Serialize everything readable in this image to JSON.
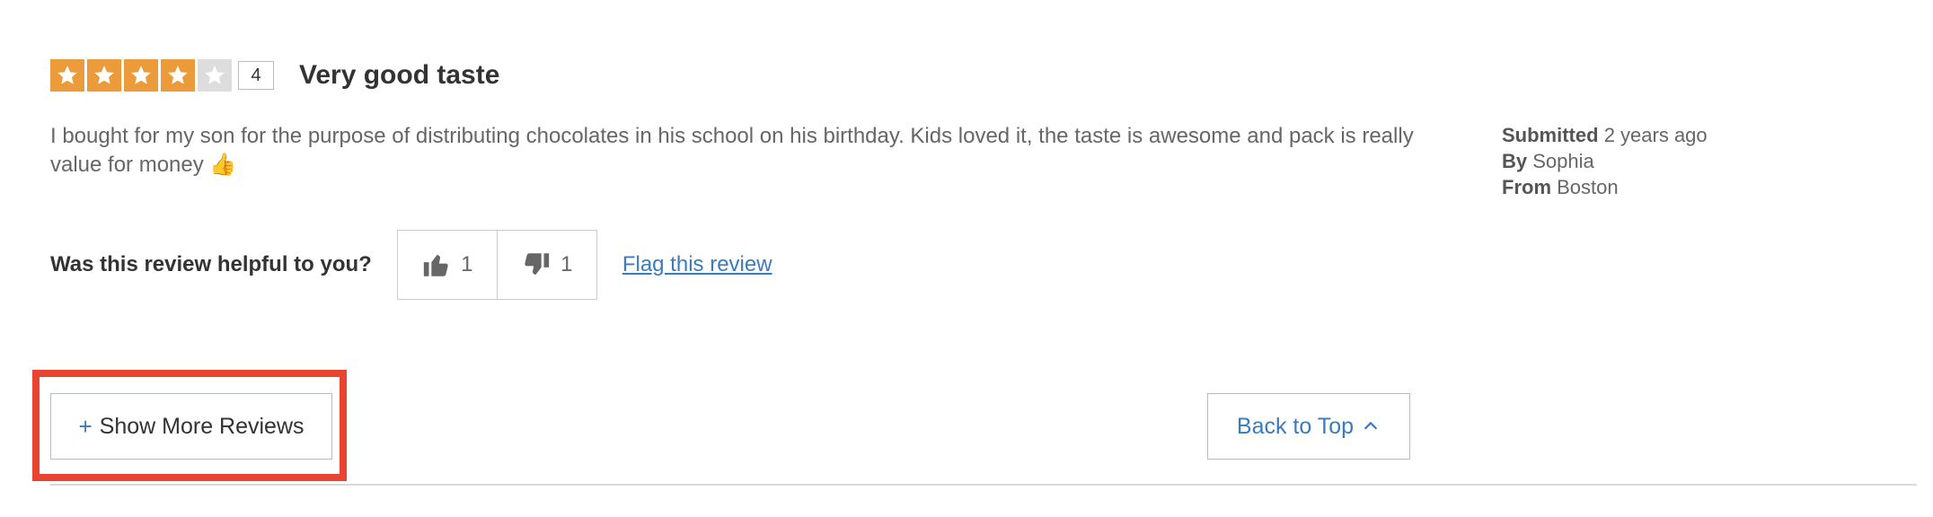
{
  "rating": {
    "value": 4,
    "max": 5,
    "count_label": "4",
    "filled_color": "#ec9b3b",
    "empty_color": "#dddddd"
  },
  "review": {
    "title": "Very good taste",
    "text": "I bought for my son for the purpose of distributing chocolates in his school on his birthday. Kids loved it, the taste is awesome and pack is really value for money 👍",
    "submitted_label": "Submitted",
    "submitted_value": "2 years ago",
    "by_label": "By",
    "by_value": "Sophia",
    "from_label": "From",
    "from_value": "Boston"
  },
  "helpful": {
    "question": "Was this review helpful to you?",
    "up_icon": "thumbs-up-icon",
    "up_count": "1",
    "down_icon": "thumbs-down-icon",
    "down_count": "1",
    "flag_label": "Flag this review"
  },
  "actions": {
    "show_more_plus": "+",
    "show_more_label": "Show More Reviews",
    "back_to_top_label": "Back to Top",
    "back_to_top_icon": "chevron-up-icon"
  },
  "colors": {
    "link": "#3a7bbf",
    "highlight": "#e8442f"
  }
}
